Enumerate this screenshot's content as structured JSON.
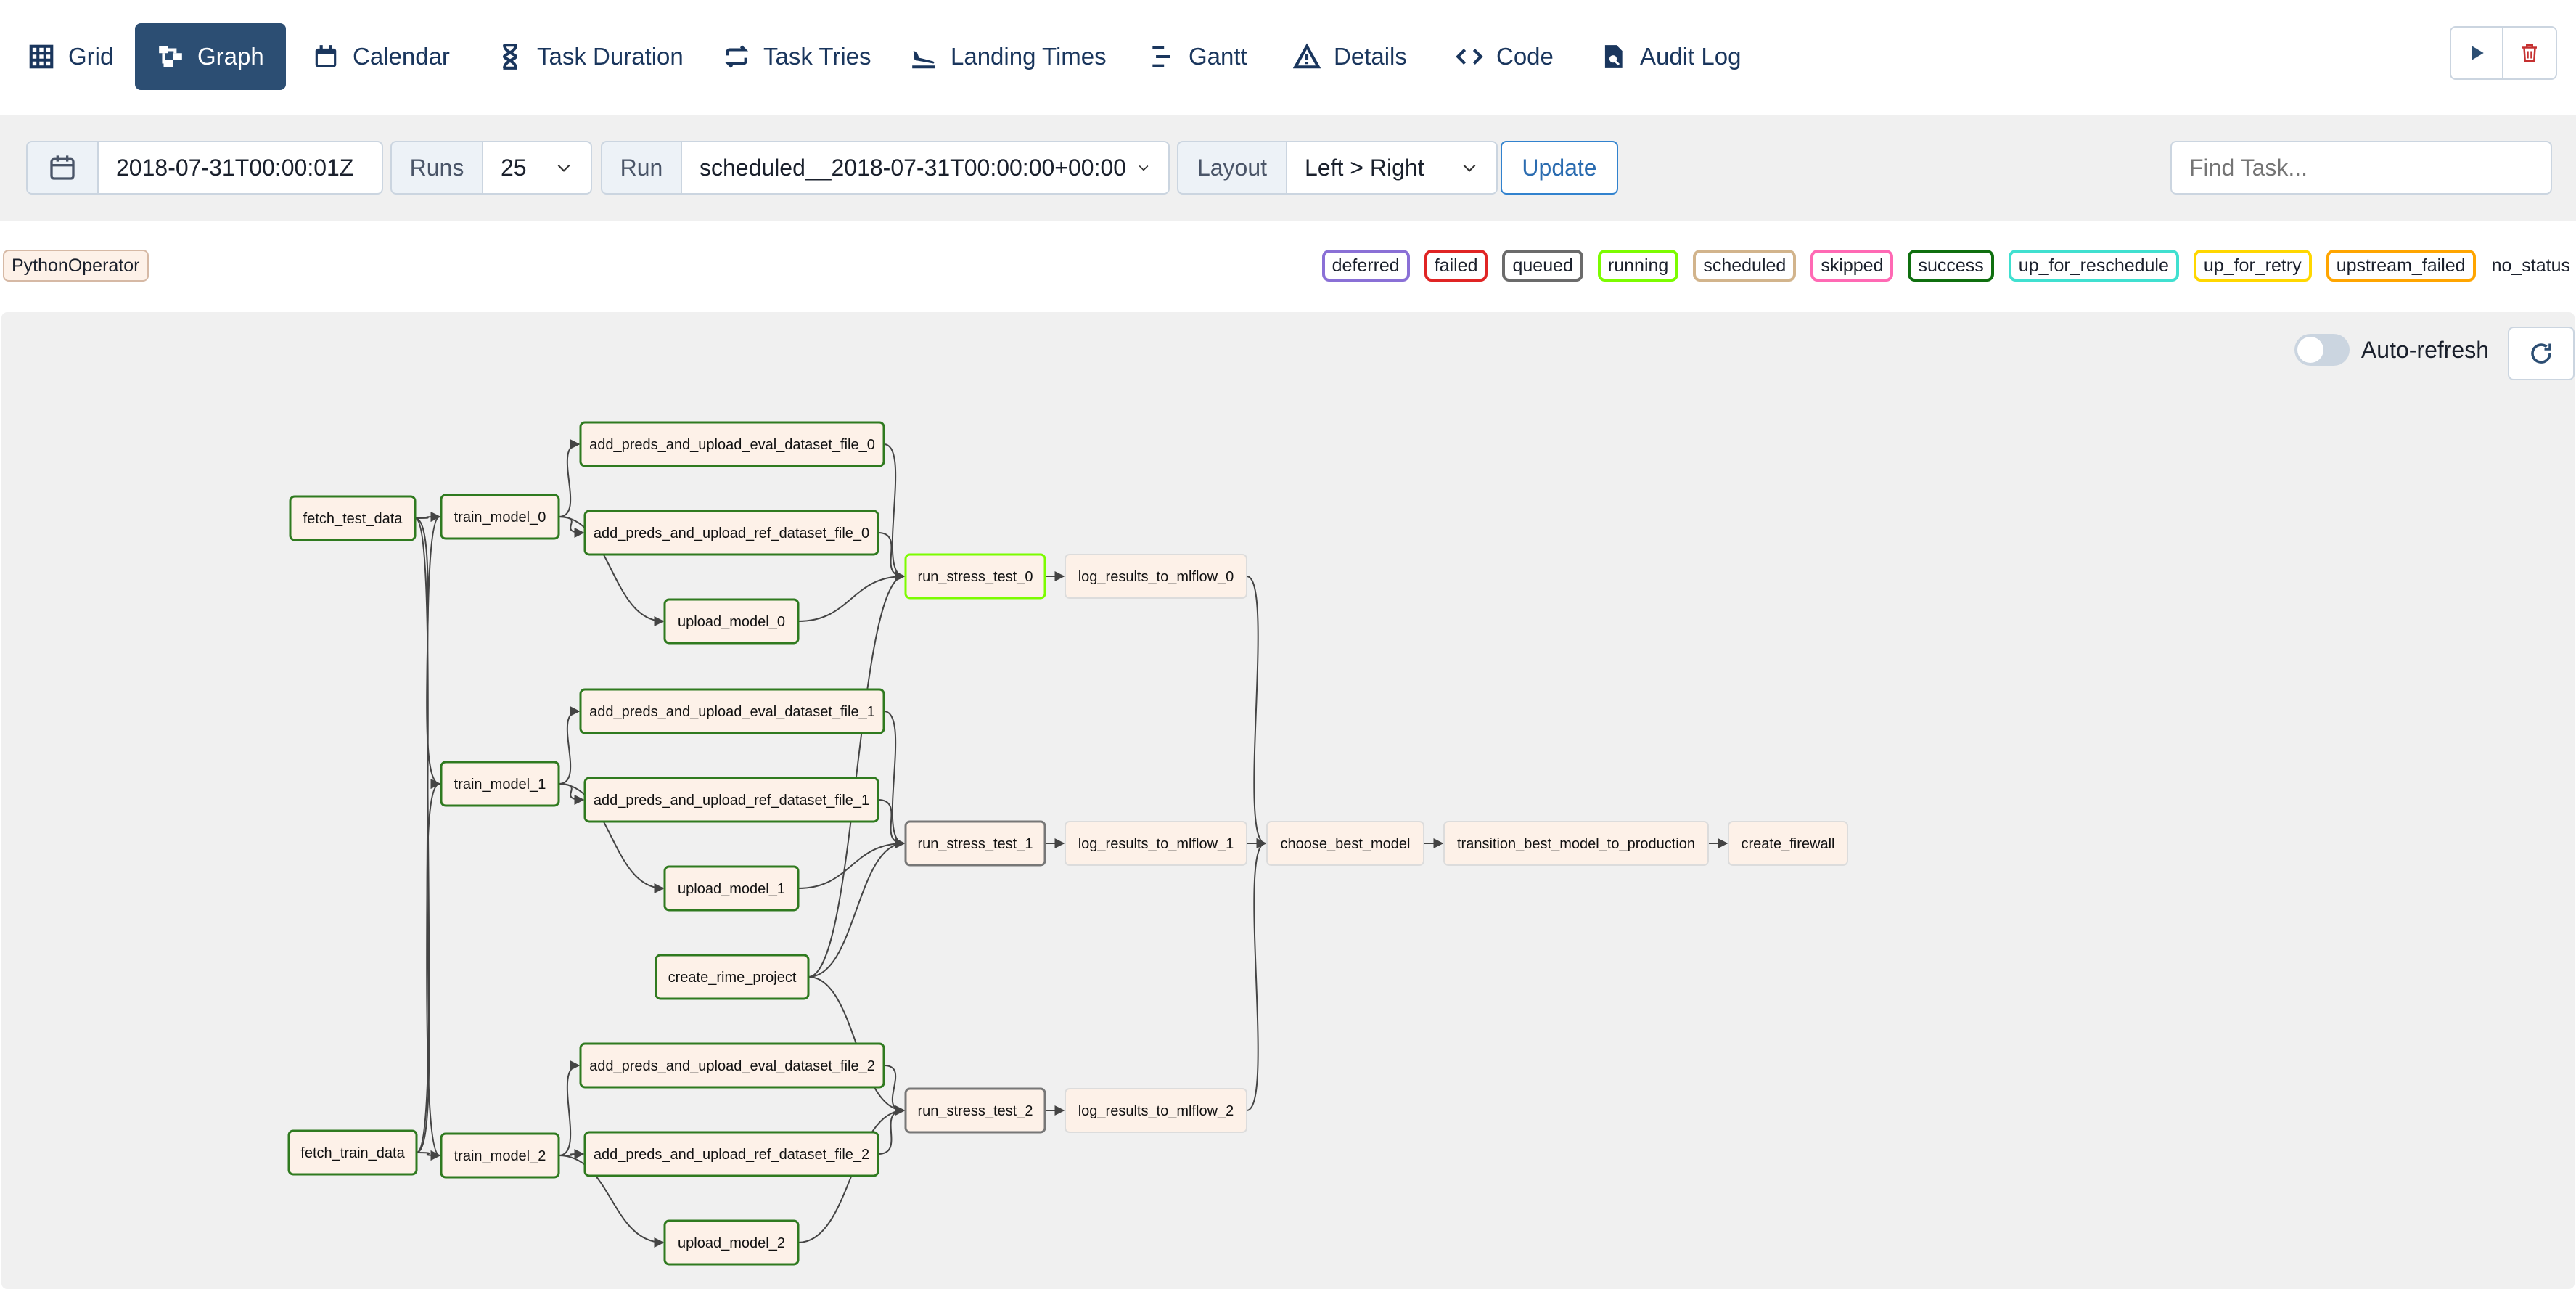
{
  "nav": {
    "tabs": [
      {
        "label": "Grid",
        "icon": "grid-icon",
        "active": false
      },
      {
        "label": "Graph",
        "icon": "graph-icon",
        "active": true
      },
      {
        "label": "Calendar",
        "icon": "calendar-icon",
        "active": false
      },
      {
        "label": "Task Duration",
        "icon": "hourglass-icon",
        "active": false
      },
      {
        "label": "Task Tries",
        "icon": "repeat-icon",
        "active": false
      },
      {
        "label": "Landing Times",
        "icon": "plane-landing-icon",
        "active": false
      },
      {
        "label": "Gantt",
        "icon": "gantt-icon",
        "active": false
      },
      {
        "label": "Details",
        "icon": "warning-triangle-icon",
        "active": false
      },
      {
        "label": "Code",
        "icon": "code-icon",
        "active": false
      },
      {
        "label": "Audit Log",
        "icon": "search-document-icon",
        "active": false
      }
    ],
    "right_buttons": [
      {
        "icon": "play-icon",
        "color": "#2c4e73"
      },
      {
        "icon": "trash-icon",
        "color": "#c53030"
      }
    ]
  },
  "filters": {
    "date_icon": "calendar-icon",
    "date_value": "2018-07-31T00:00:01Z",
    "runs_label": "Runs",
    "runs_value": "25",
    "run_label": "Run",
    "run_value": "scheduled__2018-07-31T00:00:00+00:00",
    "layout_label": "Layout",
    "layout_value": "Left > Right",
    "update_label": "Update",
    "find_placeholder": "Find Task..."
  },
  "legend": {
    "operator": "PythonOperator",
    "states": [
      {
        "label": "deferred",
        "color": "#8a70d6"
      },
      {
        "label": "failed",
        "color": "#e02424"
      },
      {
        "label": "queued",
        "color": "#6b6b6b"
      },
      {
        "label": "running",
        "color": "#7cfc00"
      },
      {
        "label": "scheduled",
        "color": "#d2b48c"
      },
      {
        "label": "skipped",
        "color": "#ff69b4"
      },
      {
        "label": "success",
        "color": "#0f6f0f"
      },
      {
        "label": "up_for_reschedule",
        "color": "#40e0d0"
      },
      {
        "label": "up_for_retry",
        "color": "#ffd700"
      },
      {
        "label": "upstream_failed",
        "color": "#ffa500"
      },
      {
        "label": "no_status",
        "color": ""
      }
    ]
  },
  "graph": {
    "auto_refresh_label": "Auto-refresh",
    "refresh_icon": "refresh-icon",
    "state_colors": {
      "success": "#2f7a1f",
      "running": "#7cfc00",
      "none": "#dcdcdc",
      "queued": "#777777"
    },
    "nodes": [
      {
        "id": "fetch_test_data",
        "state": "success"
      },
      {
        "id": "fetch_train_data",
        "state": "success"
      },
      {
        "id": "train_model_0",
        "state": "success"
      },
      {
        "id": "train_model_1",
        "state": "success"
      },
      {
        "id": "train_model_2",
        "state": "success"
      },
      {
        "id": "add_preds_and_upload_eval_dataset_file_0",
        "state": "success"
      },
      {
        "id": "add_preds_and_upload_ref_dataset_file_0",
        "state": "success"
      },
      {
        "id": "upload_model_0",
        "state": "success"
      },
      {
        "id": "add_preds_and_upload_eval_dataset_file_1",
        "state": "success"
      },
      {
        "id": "add_preds_and_upload_ref_dataset_file_1",
        "state": "success"
      },
      {
        "id": "upload_model_1",
        "state": "success"
      },
      {
        "id": "create_rime_project",
        "state": "success"
      },
      {
        "id": "add_preds_and_upload_eval_dataset_file_2",
        "state": "success"
      },
      {
        "id": "add_preds_and_upload_ref_dataset_file_2",
        "state": "success"
      },
      {
        "id": "upload_model_2",
        "state": "success"
      },
      {
        "id": "run_stress_test_0",
        "state": "running"
      },
      {
        "id": "run_stress_test_1",
        "state": "queued"
      },
      {
        "id": "run_stress_test_2",
        "state": "queued"
      },
      {
        "id": "log_results_to_mlflow_0",
        "state": "none"
      },
      {
        "id": "log_results_to_mlflow_1",
        "state": "none"
      },
      {
        "id": "log_results_to_mlflow_2",
        "state": "none"
      },
      {
        "id": "choose_best_model",
        "state": "none"
      },
      {
        "id": "transition_best_model_to_production",
        "state": "none"
      },
      {
        "id": "create_firewall",
        "state": "none"
      }
    ],
    "edges": [
      [
        "fetch_test_data",
        "train_model_0"
      ],
      [
        "fetch_test_data",
        "train_model_1"
      ],
      [
        "fetch_test_data",
        "train_model_2"
      ],
      [
        "fetch_train_data",
        "train_model_0"
      ],
      [
        "fetch_train_data",
        "train_model_1"
      ],
      [
        "fetch_train_data",
        "train_model_2"
      ],
      [
        "train_model_0",
        "add_preds_and_upload_eval_dataset_file_0"
      ],
      [
        "train_model_0",
        "add_preds_and_upload_ref_dataset_file_0"
      ],
      [
        "train_model_0",
        "upload_model_0"
      ],
      [
        "train_model_1",
        "add_preds_and_upload_eval_dataset_file_1"
      ],
      [
        "train_model_1",
        "add_preds_and_upload_ref_dataset_file_1"
      ],
      [
        "train_model_1",
        "upload_model_1"
      ],
      [
        "train_model_2",
        "add_preds_and_upload_eval_dataset_file_2"
      ],
      [
        "train_model_2",
        "add_preds_and_upload_ref_dataset_file_2"
      ],
      [
        "train_model_2",
        "upload_model_2"
      ],
      [
        "add_preds_and_upload_eval_dataset_file_0",
        "run_stress_test_0"
      ],
      [
        "add_preds_and_upload_ref_dataset_file_0",
        "run_stress_test_0"
      ],
      [
        "upload_model_0",
        "run_stress_test_0"
      ],
      [
        "create_rime_project",
        "run_stress_test_0"
      ],
      [
        "add_preds_and_upload_eval_dataset_file_1",
        "run_stress_test_1"
      ],
      [
        "add_preds_and_upload_ref_dataset_file_1",
        "run_stress_test_1"
      ],
      [
        "upload_model_1",
        "run_stress_test_1"
      ],
      [
        "create_rime_project",
        "run_stress_test_1"
      ],
      [
        "add_preds_and_upload_eval_dataset_file_2",
        "run_stress_test_2"
      ],
      [
        "add_preds_and_upload_ref_dataset_file_2",
        "run_stress_test_2"
      ],
      [
        "upload_model_2",
        "run_stress_test_2"
      ],
      [
        "create_rime_project",
        "run_stress_test_2"
      ],
      [
        "run_stress_test_0",
        "log_results_to_mlflow_0"
      ],
      [
        "run_stress_test_1",
        "log_results_to_mlflow_1"
      ],
      [
        "run_stress_test_2",
        "log_results_to_mlflow_2"
      ],
      [
        "log_results_to_mlflow_0",
        "choose_best_model"
      ],
      [
        "log_results_to_mlflow_1",
        "choose_best_model"
      ],
      [
        "log_results_to_mlflow_2",
        "choose_best_model"
      ],
      [
        "choose_best_model",
        "transition_best_model_to_production"
      ],
      [
        "transition_best_model_to_production",
        "create_firewall"
      ]
    ]
  }
}
